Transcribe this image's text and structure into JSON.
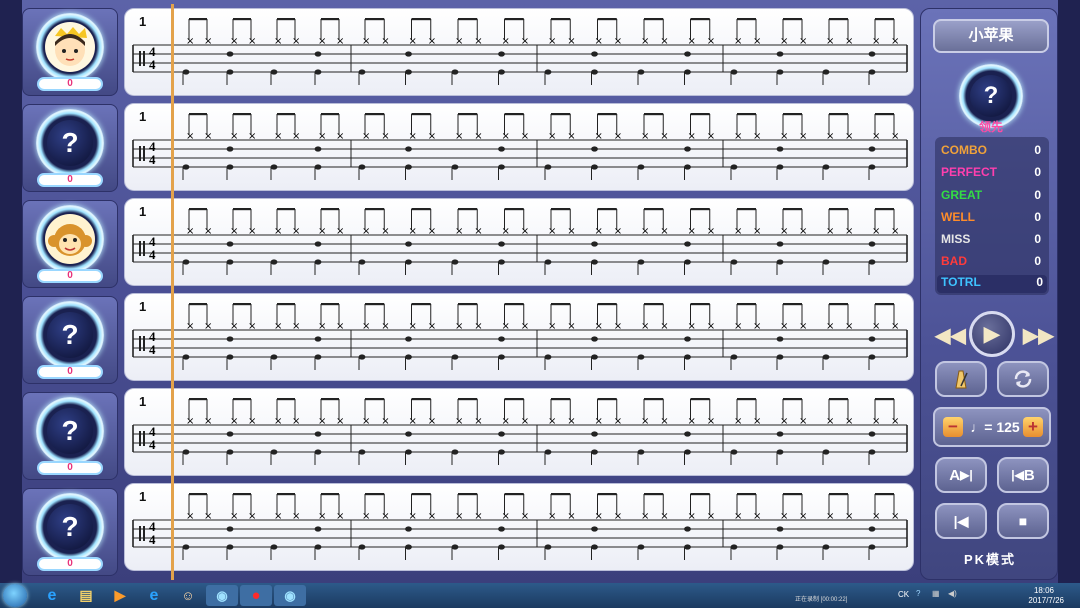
{
  "players": [
    {
      "avatar": "boy-avatar",
      "score": "0"
    },
    {
      "avatar": "unknown",
      "score": "0"
    },
    {
      "avatar": "monkey-avatar",
      "score": "0"
    },
    {
      "avatar": "unknown",
      "score": "0"
    },
    {
      "avatar": "unknown",
      "score": "0"
    },
    {
      "avatar": "unknown",
      "score": "0"
    }
  ],
  "unknown_glyph": "?",
  "staff": {
    "measure_number": "1",
    "time_signature_top": "4",
    "time_signature_bottom": "4"
  },
  "panel": {
    "song_title": "小苹果",
    "leader_glyph": "?",
    "leader_label": "领先",
    "stats": [
      {
        "label": "COMBO",
        "value": "0",
        "color": "#f0a23a"
      },
      {
        "label": "PERFECT",
        "value": "0",
        "color": "#ff3fae"
      },
      {
        "label": "GREAT",
        "value": "0",
        "color": "#33dd44"
      },
      {
        "label": "WELL",
        "value": "0",
        "color": "#ff8c2a"
      },
      {
        "label": "MISS",
        "value": "0",
        "color": "#e6e6e6"
      },
      {
        "label": "BAD",
        "value": "0",
        "color": "#ff3b3b"
      },
      {
        "label": "TOTRL",
        "value": "0",
        "color": "#3ec3ff"
      }
    ],
    "tempo_minus": "−",
    "tempo_value": "♩= 125",
    "tempo_plus": "+",
    "ab_a_label": "A",
    "ab_b_label": "B",
    "mode_label": "PK模式"
  },
  "taskbar": {
    "recording_text": "正在录制 [00:00:22]",
    "clock_time": "18:06",
    "clock_date": "2017/7/26",
    "lang": "CK"
  }
}
